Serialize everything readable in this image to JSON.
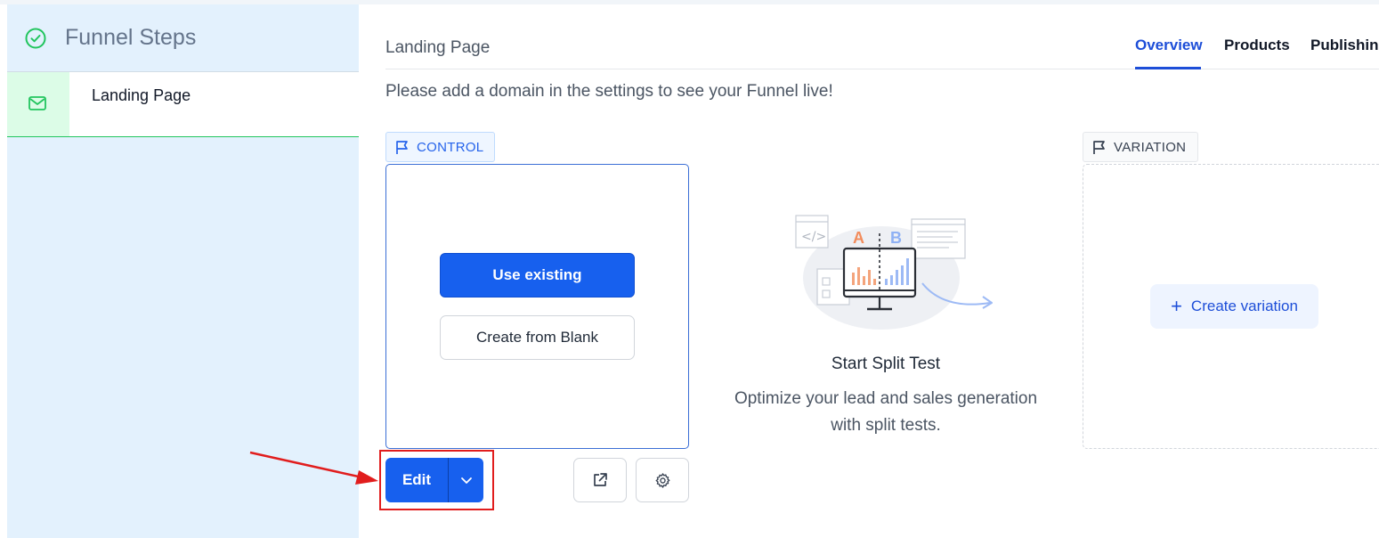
{
  "sidebar": {
    "title": "Funnel Steps",
    "steps": [
      {
        "label": "Landing Page",
        "icon": "mail-icon",
        "selected": true
      }
    ]
  },
  "header": {
    "page_title": "Landing Page",
    "tabs": [
      {
        "label": "Overview",
        "active": true
      },
      {
        "label": "Products",
        "active": false
      },
      {
        "label": "Publishing",
        "active": false
      }
    ]
  },
  "notice": "Please add a domain in the settings to see your Funnel live!",
  "control": {
    "badge": "CONTROL",
    "use_existing": "Use existing",
    "create_blank": "Create from Blank",
    "edit": "Edit"
  },
  "split_test": {
    "title": "Start Split Test",
    "description": "Optimize your lead and sales generation with split tests.",
    "illustration_labels": {
      "a": "A",
      "b": "B"
    }
  },
  "variation": {
    "badge": "VARIATION",
    "create_label": "Create variation"
  },
  "colors": {
    "primary": "#1760ee",
    "sidebar_bg": "#e3f1fd",
    "success": "#22c55e",
    "highlight": "#e11d1d"
  }
}
